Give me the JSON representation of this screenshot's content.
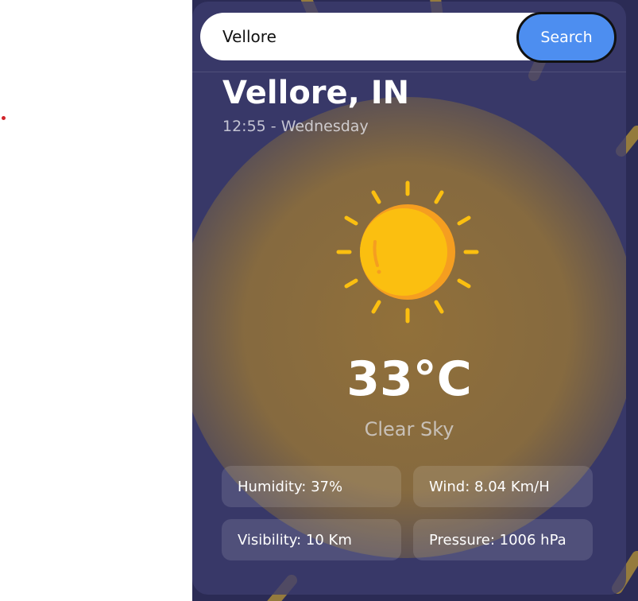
{
  "search": {
    "value": "Vellore",
    "button_label": "Search"
  },
  "location": {
    "city": "Vellore, IN",
    "datetime": "12:55 - Wednesday"
  },
  "weather": {
    "icon": "sun-icon",
    "temperature": "33°C",
    "condition": "Clear Sky"
  },
  "stats": [
    {
      "label": "Humidity: 37%"
    },
    {
      "label": "Wind: 8.04 Km/H"
    },
    {
      "label": "Visibility: 10 Km"
    },
    {
      "label": "Pressure: 1006 hPa"
    }
  ],
  "colors": {
    "accent": "#4d8ef0",
    "sun": "#fbbf10",
    "sun_shade": "#f59e20",
    "card_background": "#3c3c6e",
    "glow": "#96733a"
  }
}
